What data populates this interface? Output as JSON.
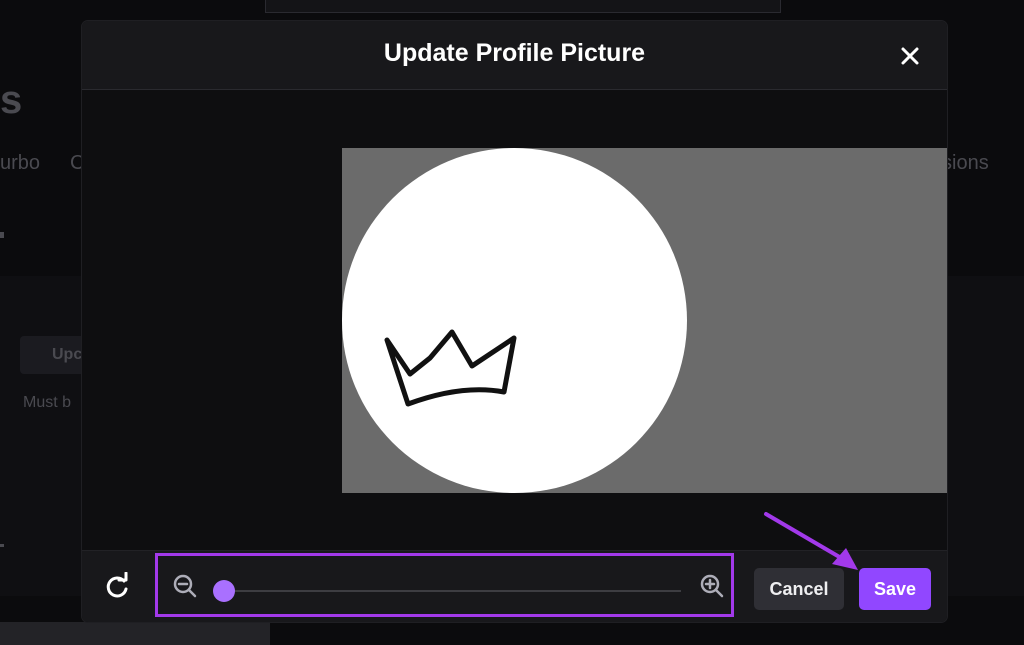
{
  "background": {
    "title_fragment": "s",
    "tab_left_fragment": "urbo",
    "tab_left2_fragment": "C",
    "tab_right_fragment": "sions",
    "chip_fragment": "Upc",
    "note_fragment": "Must b"
  },
  "modal": {
    "title": "Update Profile Picture",
    "close_icon": "close-icon"
  },
  "crop": {
    "image_description_icon": "crown-icon"
  },
  "footer": {
    "rotate_icon": "rotate-icon",
    "zoom_out_icon": "zoom-out-icon",
    "zoom_in_icon": "zoom-in-icon",
    "zoom_level": 0.0,
    "cancel_label": "Cancel",
    "save_label": "Save"
  },
  "colors": {
    "accent": "#9147ff",
    "slider_thumb": "#a970ff",
    "highlight": "#a239ea",
    "modal_bg": "#18181b"
  }
}
